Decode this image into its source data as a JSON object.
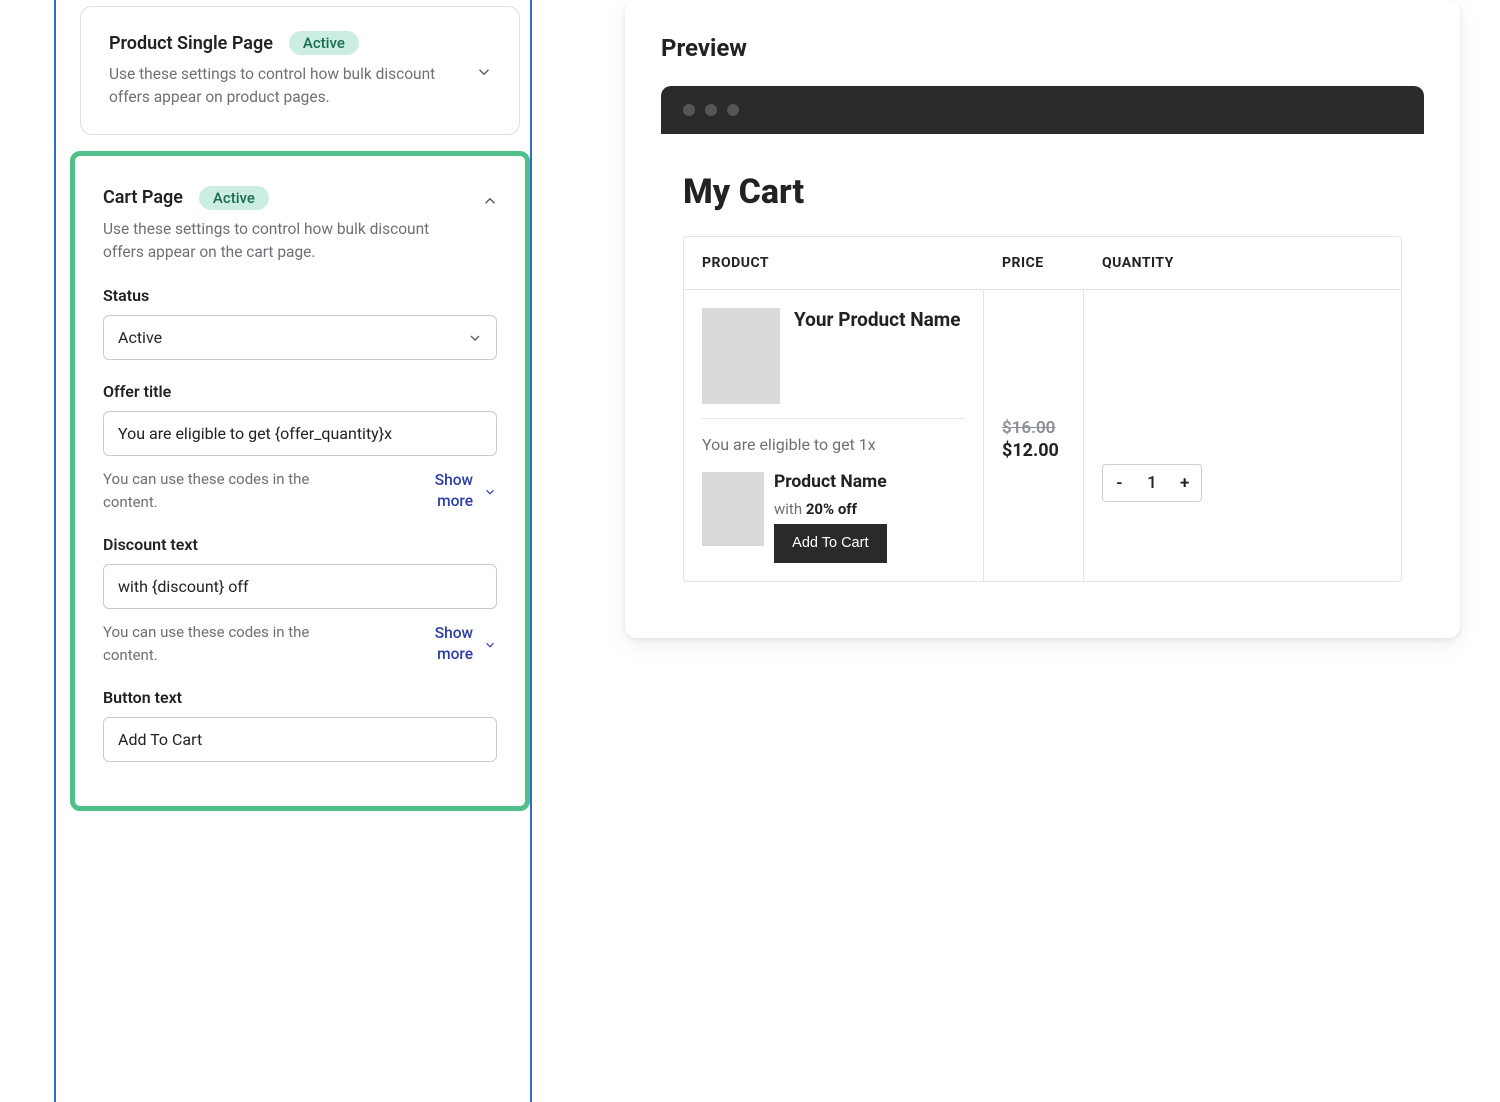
{
  "settings": {
    "productSinglePage": {
      "title": "Product Single Page",
      "badge": "Active",
      "description": "Use these settings to control how bulk discount offers appear on product pages."
    },
    "cartPage": {
      "title": "Cart Page",
      "badge": "Active",
      "description": "Use these settings to control how bulk discount offers appear on the cart page.",
      "statusLabel": "Status",
      "statusValue": "Active",
      "offerTitleLabel": "Offer title",
      "offerTitleValue": "You are eligible to get {offer_quantity}x",
      "offerTitleHelper": "You can use these codes in the content.",
      "showMore1": "Show more",
      "discountTextLabel": "Discount text",
      "discountTextValue": "with {discount} off",
      "discountTextHelper": "You can use these codes in the content.",
      "showMore2": "Show more",
      "buttonTextLabel": "Button text",
      "buttonTextValue": "Add To Cart"
    }
  },
  "preview": {
    "title": "Preview",
    "cartHeading": "My Cart",
    "columns": {
      "product": "PRODUCT",
      "price": "PRICE",
      "quantity": "QUANTITY"
    },
    "productName": "Your Product Name",
    "eligibleText": "You are eligible to get 1x",
    "offerProductName": "Product Name",
    "discountPrefix": "with ",
    "discountValue": "20% off",
    "addToCart": "Add To Cart",
    "priceOld": "$16.00",
    "priceNew": "$12.00",
    "qty": "1"
  }
}
